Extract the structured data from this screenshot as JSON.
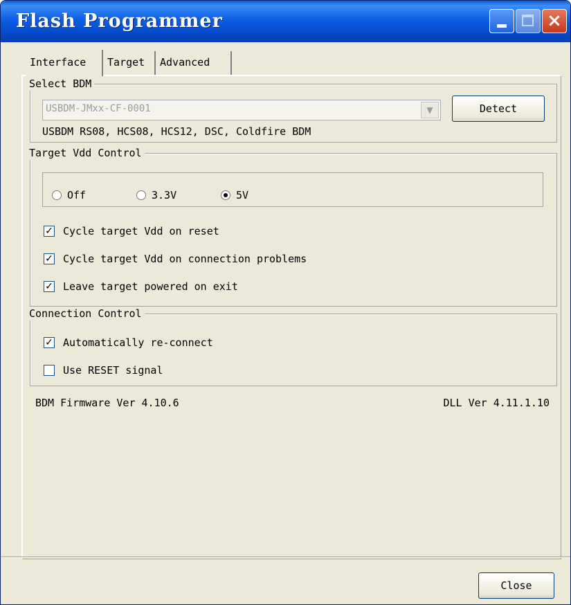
{
  "window": {
    "title": "Flash Programmer"
  },
  "titlebar_buttons": {
    "minimize": "minimize-icon",
    "maximize": "maximize-icon",
    "close": "×"
  },
  "tabs": [
    {
      "label": "Interface",
      "active": true
    },
    {
      "label": "Target",
      "active": false
    },
    {
      "label": "Advanced",
      "active": false
    }
  ],
  "select_bdm": {
    "legend": "Select BDM",
    "combo_value": "USBDM-JMxx-CF-0001",
    "detect_label": "Detect",
    "supported": "USBDM RS08, HCS08, HCS12, DSC, Coldfire BDM"
  },
  "target_vdd": {
    "legend": "Target Vdd Control",
    "radios": [
      {
        "label": "Off",
        "selected": false
      },
      {
        "label": "3.3V",
        "selected": false
      },
      {
        "label": "5V",
        "selected": true
      }
    ],
    "checks": [
      {
        "label": "Cycle target Vdd on reset",
        "checked": true
      },
      {
        "label": "Cycle target Vdd on connection problems",
        "checked": true
      },
      {
        "label": "Leave target powered on exit",
        "checked": true
      }
    ]
  },
  "connection": {
    "legend": "Connection Control",
    "checks": [
      {
        "label": "Automatically re-connect",
        "checked": true
      },
      {
        "label": "Use RESET signal",
        "checked": false
      }
    ]
  },
  "status": {
    "firmware": "BDM Firmware Ver 4.10.6",
    "dll": "DLL Ver 4.11.1.10"
  },
  "footer": {
    "close_label": "Close"
  },
  "colors": {
    "titlebar": "#0a5fd6",
    "face": "#ece9d8",
    "disabled_text": "#9a9a9a"
  }
}
